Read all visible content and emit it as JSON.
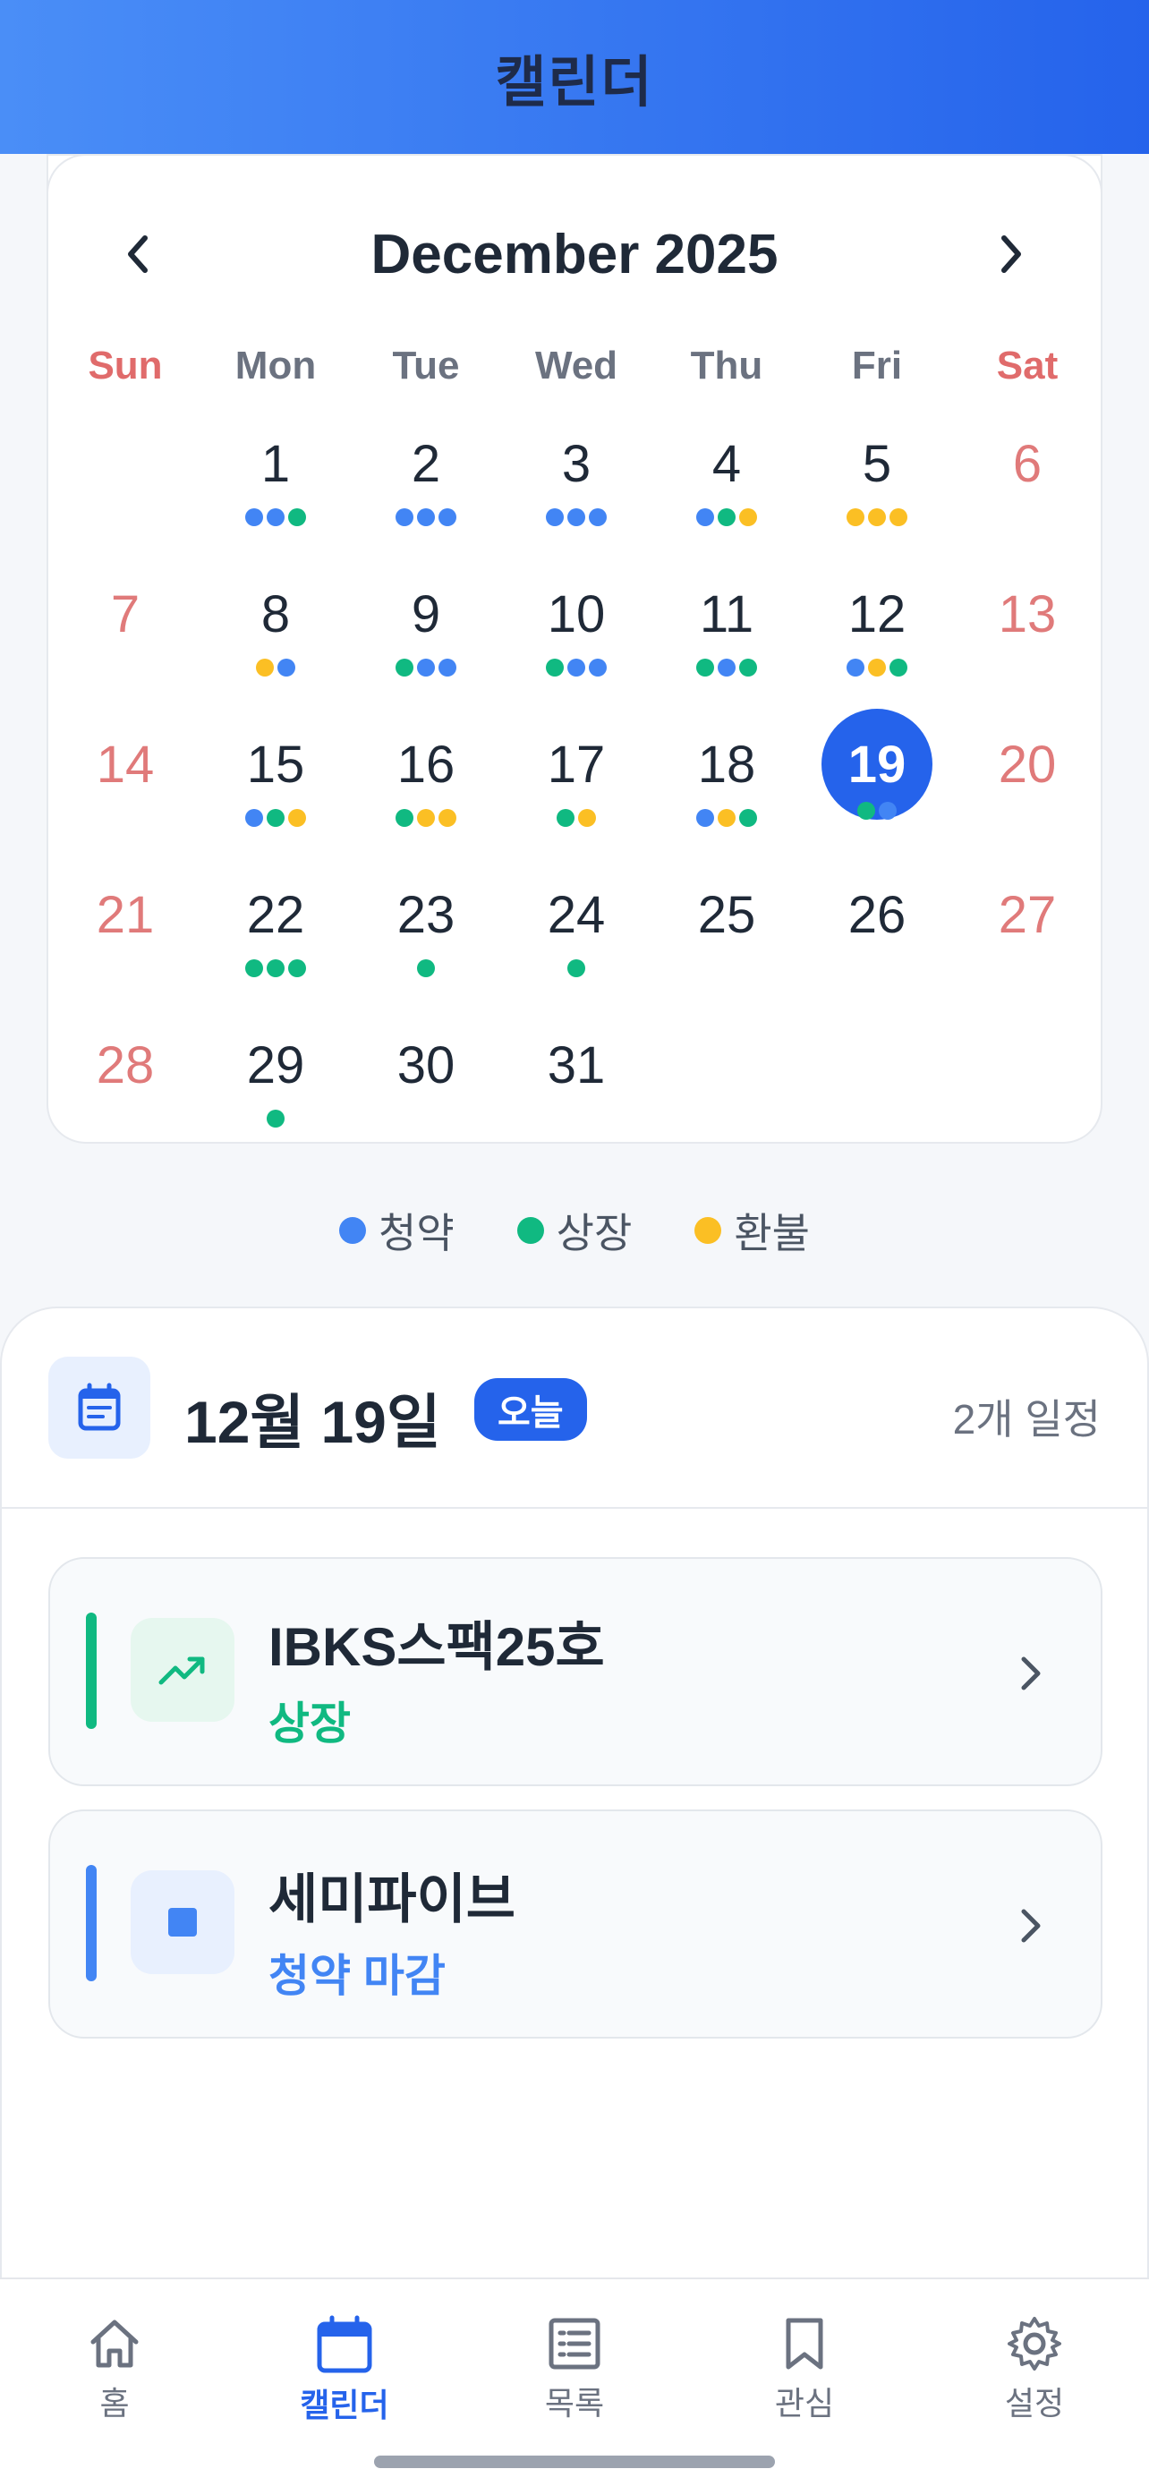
{
  "header": {
    "title": "캘린더"
  },
  "calendar": {
    "month_title": "December 2025",
    "weekdays": [
      "Sun",
      "Mon",
      "Tue",
      "Wed",
      "Thu",
      "Fri",
      "Sat"
    ],
    "today": 19,
    "days": [
      {
        "d": ""
      },
      {
        "d": "1",
        "dots": [
          "blue",
          "blue",
          "green"
        ]
      },
      {
        "d": "2",
        "dots": [
          "blue",
          "blue",
          "blue"
        ]
      },
      {
        "d": "3",
        "dots": [
          "blue",
          "blue",
          "blue"
        ]
      },
      {
        "d": "4",
        "dots": [
          "blue",
          "green",
          "yellow"
        ]
      },
      {
        "d": "5",
        "dots": [
          "yellow",
          "yellow",
          "yellow"
        ]
      },
      {
        "d": "6"
      },
      {
        "d": "7"
      },
      {
        "d": "8",
        "dots": [
          "yellow",
          "blue"
        ]
      },
      {
        "d": "9",
        "dots": [
          "green",
          "blue",
          "blue"
        ]
      },
      {
        "d": "10",
        "dots": [
          "green",
          "blue",
          "blue"
        ]
      },
      {
        "d": "11",
        "dots": [
          "green",
          "blue",
          "green"
        ]
      },
      {
        "d": "12",
        "dots": [
          "blue",
          "yellow",
          "green"
        ]
      },
      {
        "d": "13"
      },
      {
        "d": "14"
      },
      {
        "d": "15",
        "dots": [
          "blue",
          "green",
          "yellow"
        ]
      },
      {
        "d": "16",
        "dots": [
          "green",
          "yellow",
          "yellow"
        ]
      },
      {
        "d": "17",
        "dots": [
          "green",
          "yellow"
        ]
      },
      {
        "d": "18",
        "dots": [
          "blue",
          "yellow",
          "green"
        ]
      },
      {
        "d": "19",
        "dots": [
          "green",
          "blue"
        ]
      },
      {
        "d": "20"
      },
      {
        "d": "21"
      },
      {
        "d": "22",
        "dots": [
          "green",
          "green",
          "green"
        ]
      },
      {
        "d": "23",
        "dots": [
          "green"
        ]
      },
      {
        "d": "24",
        "dots": [
          "green"
        ]
      },
      {
        "d": "25"
      },
      {
        "d": "26"
      },
      {
        "d": "27"
      },
      {
        "d": "28"
      },
      {
        "d": "29",
        "dots": [
          "green"
        ]
      },
      {
        "d": "30"
      },
      {
        "d": "31"
      },
      {
        "d": ""
      },
      {
        "d": ""
      },
      {
        "d": ""
      }
    ]
  },
  "colors": {
    "blue": "#4285f4",
    "green": "#10b981",
    "yellow": "#fbbf24",
    "primary": "#2563eb"
  },
  "legend": [
    {
      "label": "청약",
      "color": "blue"
    },
    {
      "label": "상장",
      "color": "green"
    },
    {
      "label": "환불",
      "color": "yellow"
    }
  ],
  "detail": {
    "date": "12월 19일",
    "today_badge": "오늘",
    "count": "2개 일정",
    "events": [
      {
        "name": "IBKS스팩25호",
        "type": "상장",
        "color": "#10b981",
        "bg": "#e6f7ef",
        "icon": "trending-up-icon"
      },
      {
        "name": "세미파이브",
        "type": "청약 마감",
        "color": "#4285f4",
        "bg": "#e8f0fe",
        "icon": "square-icon"
      }
    ]
  },
  "bottom_nav": [
    {
      "label": "홈",
      "icon": "home-icon"
    },
    {
      "label": "캘린더",
      "icon": "calendar-icon",
      "active": true
    },
    {
      "label": "목록",
      "icon": "list-icon"
    },
    {
      "label": "관심",
      "icon": "bookmark-icon"
    },
    {
      "label": "설정",
      "icon": "gear-icon"
    }
  ]
}
